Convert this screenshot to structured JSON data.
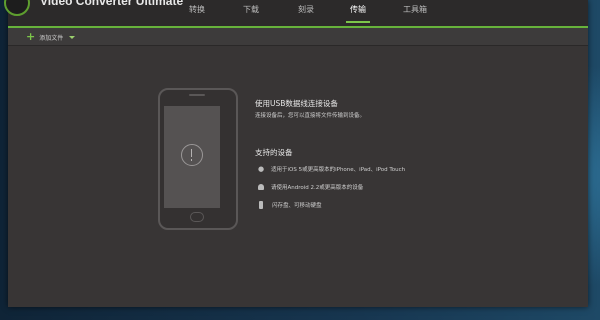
{
  "app": {
    "title": "Video Converter Ultimate"
  },
  "tabs": [
    {
      "label": "转换",
      "active": false
    },
    {
      "label": "下载",
      "active": false
    },
    {
      "label": "刻录",
      "active": false
    },
    {
      "label": "传输",
      "active": true
    },
    {
      "label": "工具箱",
      "active": false
    }
  ],
  "toolbar": {
    "add_files_label": "添加文件"
  },
  "main": {
    "connect_heading": "使用USB数据线连接设备",
    "connect_sub": "连接设备后，您可以直接将文件传输到设备。",
    "supported_heading": "支持的设备",
    "devices": [
      {
        "icon": "apple-icon",
        "text": "适用于iOS 5或更高版本的iPhone、iPad、iPod Touch"
      },
      {
        "icon": "android-icon",
        "text": "请使用Android 2.2或更高版本的设备"
      },
      {
        "icon": "usb-drive-icon",
        "text": "闪存盘、可移动硬盘"
      }
    ]
  },
  "colors": {
    "accent": "#7cc54a",
    "window_bg": "#383535",
    "titlebar_bg": "#2c2a2a"
  }
}
